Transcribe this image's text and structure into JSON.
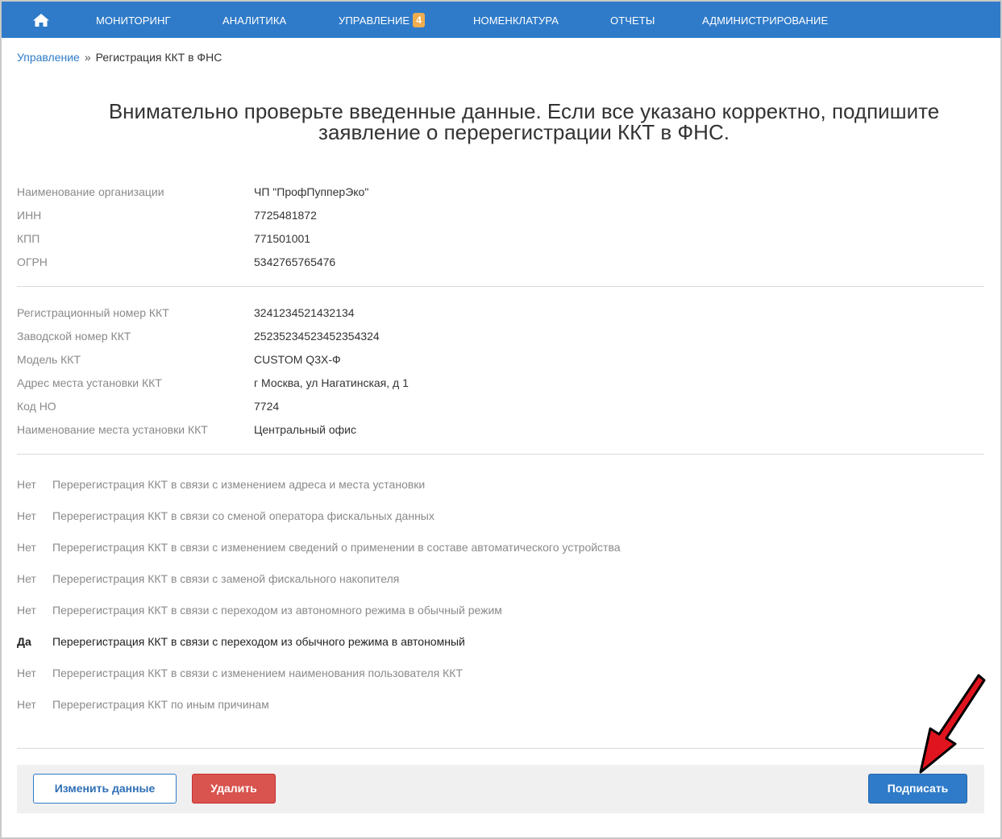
{
  "nav": {
    "home_icon": "home-icon",
    "items": [
      {
        "label": "МОНИТОРИНГ"
      },
      {
        "label": "АНАЛИТИКА"
      },
      {
        "label": "УПРАВЛЕНИЕ",
        "badge": "4"
      },
      {
        "label": "НОМЕНКЛАТУРА"
      },
      {
        "label": "ОТЧЕТЫ"
      },
      {
        "label": "АДМИНИСТРИРОВАНИЕ"
      }
    ]
  },
  "breadcrumb": {
    "parent": "Управление",
    "separator": "»",
    "current": "Регистрация ККТ в ФНС"
  },
  "heading": {
    "line1": "Внимательно проверьте введенные данные. Если все указано корректно, подпишите",
    "line2": "заявление о перерегистрации ККТ в ФНС."
  },
  "organization": [
    {
      "label": "Наименование организации",
      "value": "ЧП \"ПрофПупперЭко\""
    },
    {
      "label": "ИНН",
      "value": "7725481872"
    },
    {
      "label": "КПП",
      "value": "771501001"
    },
    {
      "label": "ОГРН",
      "value": "5342765765476"
    }
  ],
  "kkt": [
    {
      "label": "Регистрационный номер ККТ",
      "value": "3241234521432134"
    },
    {
      "label": "Заводской номер ККТ",
      "value": "25235234523452354324"
    },
    {
      "label": "Модель ККТ",
      "value": "CUSTOM Q3X-Ф"
    },
    {
      "label": "Адрес места установки ККТ",
      "value": "г Москва, ул Нагатинская, д 1"
    },
    {
      "label": "Код НО",
      "value": "7724"
    },
    {
      "label": "Наименование места установки ККТ",
      "value": "Центральный офис"
    }
  ],
  "reasons": [
    {
      "flag": "Нет",
      "text": "Перерегистрация ККТ в связи с изменением адреса и места установки"
    },
    {
      "flag": "Нет",
      "text": "Перерегистрация ККТ в связи со сменой оператора фискальных данных"
    },
    {
      "flag": "Нет",
      "text": "Перерегистрация ККТ в связи с изменением сведений о применении в составе автоматического устройства"
    },
    {
      "flag": "Нет",
      "text": "Перерегистрация ККТ в связи с заменой фискального накопителя"
    },
    {
      "flag": "Нет",
      "text": "Перерегистрация ККТ в связи с переходом из автономного режима в обычный режим"
    },
    {
      "flag": "Да",
      "text": "Перерегистрация ККТ в связи с переходом из обычного режима в автономный"
    },
    {
      "flag": "Нет",
      "text": "Перерегистрация ККТ в связи с изменением наименования пользователя ККТ"
    },
    {
      "flag": "Нет",
      "text": "Перерегистрация ККТ по иным причинам"
    }
  ],
  "buttons": {
    "edit": "Изменить данные",
    "delete": "Удалить",
    "sign": "Подписать"
  },
  "colors": {
    "nav_bg": "#2f7bc9",
    "badge": "#f0ad4e",
    "delete": "#d9534f",
    "annotation_arrow": "#e0141e"
  }
}
